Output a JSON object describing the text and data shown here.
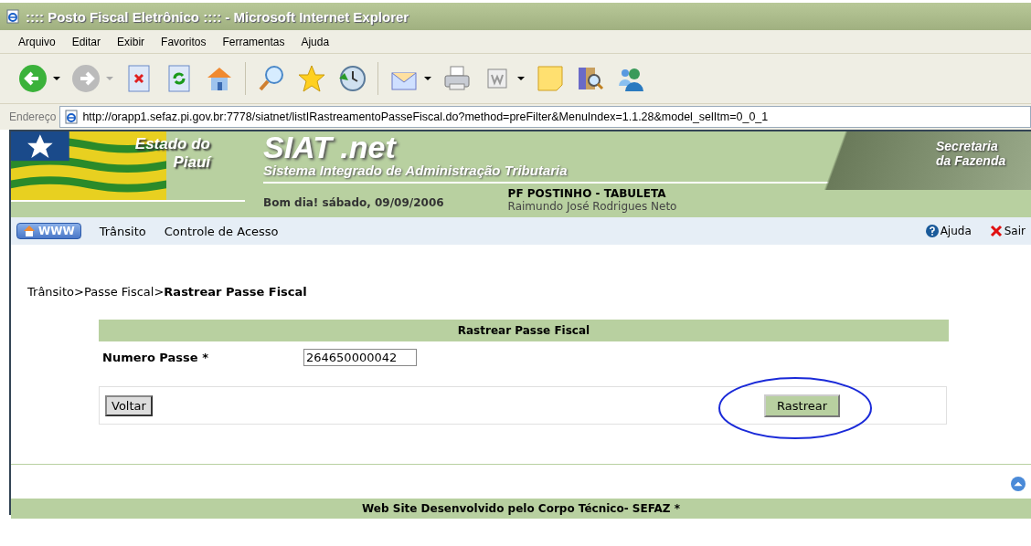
{
  "window": {
    "title": ":::: Posto Fiscal Eletrônico :::: - Microsoft Internet Explorer"
  },
  "menu": [
    "Arquivo",
    "Editar",
    "Exibir",
    "Favoritos",
    "Ferramentas",
    "Ajuda"
  ],
  "address": {
    "label": "Endereço",
    "value": "http://orapp1.sefaz.pi.gov.br:7778/siatnet/listIRastreamentoPasseFiscal.do?method=preFilter&MenuIndex=1.1.28&model_selItm=0_0_1"
  },
  "header": {
    "state_line1": "Estado do",
    "state_line2": "Piauí",
    "app_name": "SIAT .net",
    "app_subtitle": "Sistema Integrado de Administração Tributaria",
    "dept_line1": "Secretaria",
    "dept_line2": "da Fazenda",
    "greeting": "Bom dia! sábado, 09/09/2006",
    "post": "PF POSTINHO - TABULETA",
    "user": "Raimundo José Rodrigues Neto"
  },
  "nav": {
    "www": "WWW",
    "items": [
      "Trânsito",
      "Controle de Acesso"
    ],
    "help": "Ajuda",
    "exit": "Sair"
  },
  "breadcrumb": {
    "path": "Trânsito>Passe Fiscal>",
    "current": "Rastrear Passe Fiscal"
  },
  "form": {
    "title": "Rastrear Passe Fiscal",
    "field_label": "Numero Passe *",
    "field_value": "264650000042",
    "back": "Voltar",
    "submit": "Rastrear"
  },
  "footer": "Web Site Desenvolvido pelo Corpo Técnico- SEFAZ *"
}
